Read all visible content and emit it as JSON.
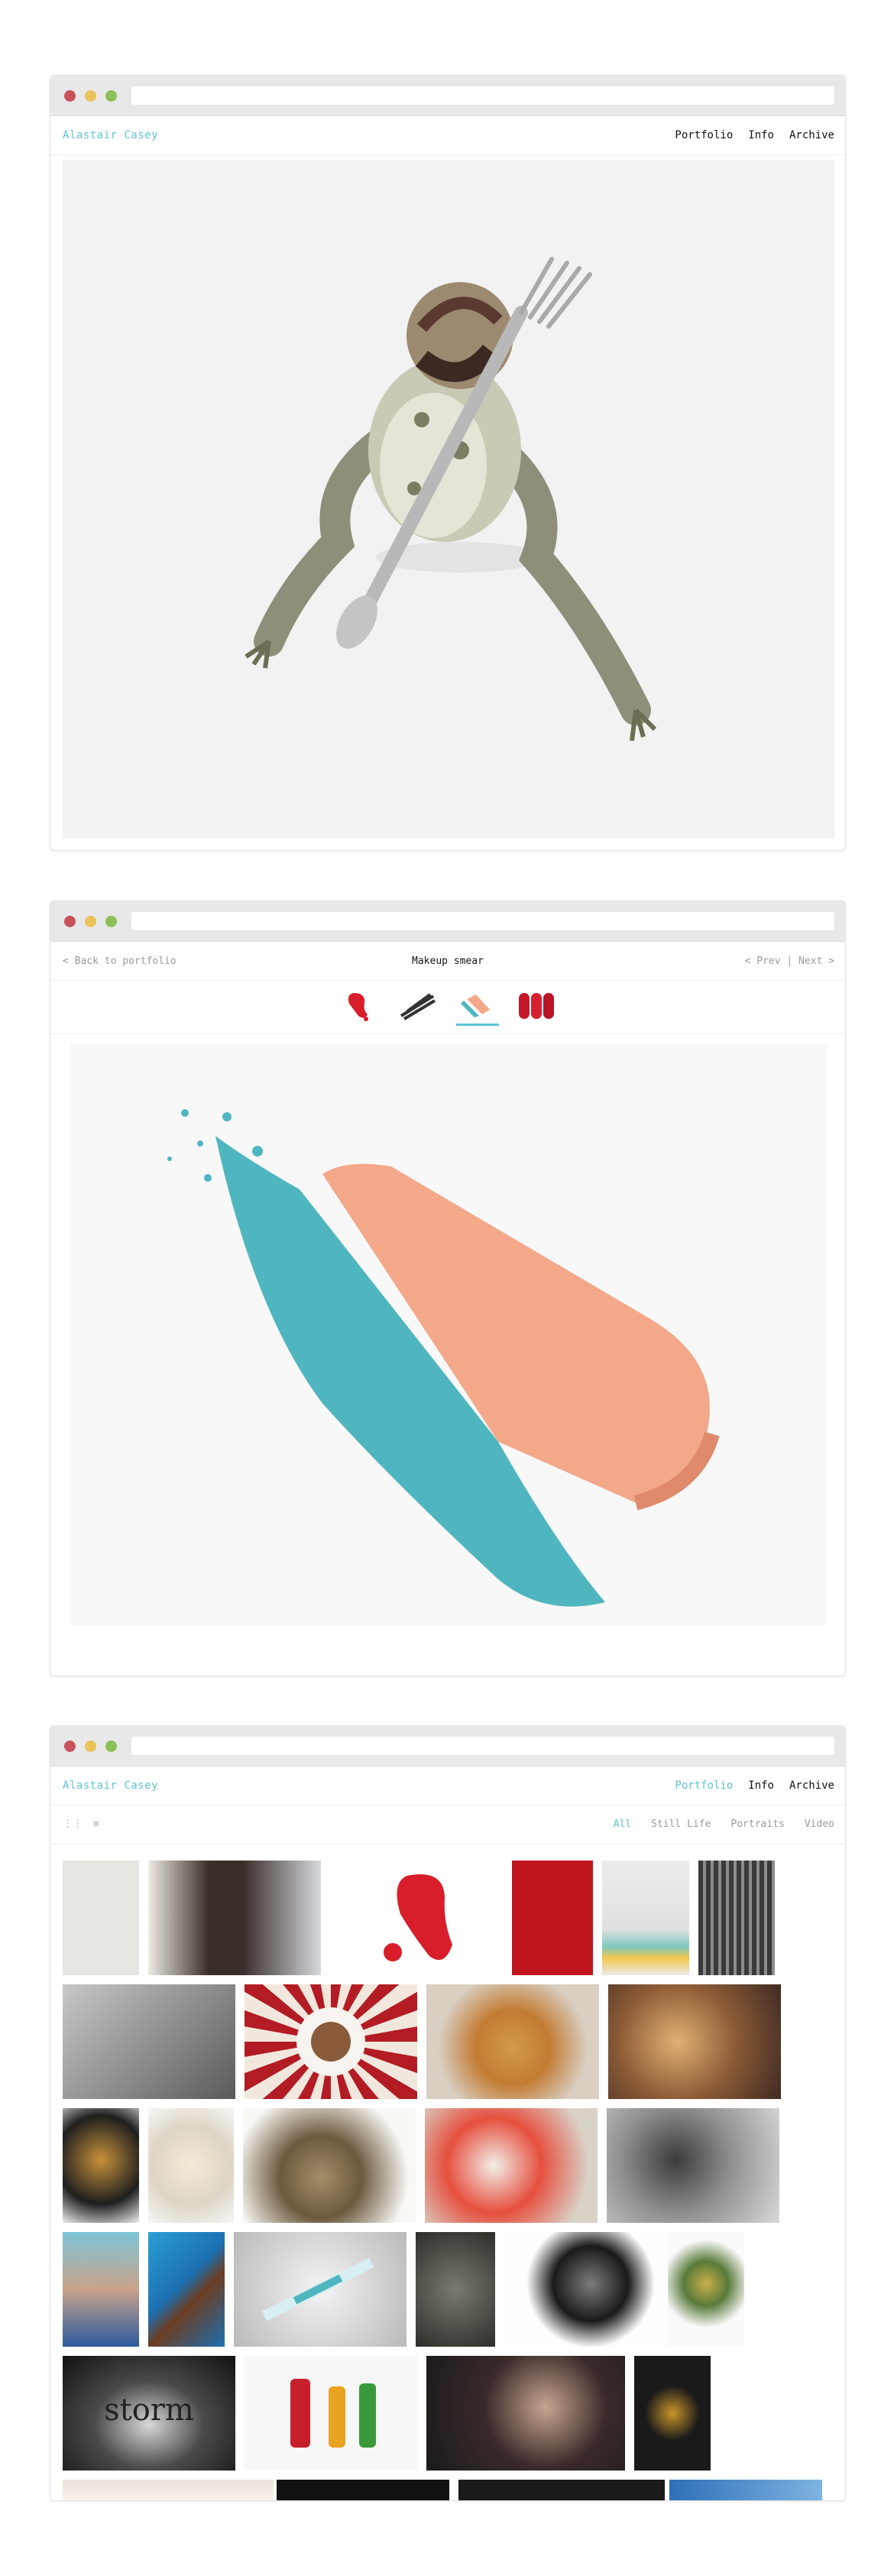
{
  "window1": {
    "brand": "Alastair Casey",
    "menu": [
      "Portfolio",
      "Info",
      "Archive"
    ]
  },
  "window2": {
    "back": "< Back to portfolio",
    "title": "Makeup smear",
    "pager": "< Prev | Next >",
    "thumbnails": [
      "red-paint-drip",
      "black-brush-strokes",
      "makeup-smear",
      "red-lipstick-smears"
    ],
    "selected_thumbnail": "makeup-smear"
  },
  "window3": {
    "brand": "Alastair Casey",
    "menu": [
      "Portfolio",
      "Info",
      "Archive"
    ],
    "active_menu": "Portfolio",
    "view_icons": [
      "grid-icon",
      "list-icon"
    ],
    "filters": [
      "All",
      "Still Life",
      "Portraits",
      "Video"
    ],
    "active_filter": "All",
    "storm_text": "storm"
  },
  "colors": {
    "accent": "#5ec3d4",
    "dot_red": "#c8525a",
    "dot_yellow": "#e9c25a",
    "dot_green": "#8cbf55"
  }
}
